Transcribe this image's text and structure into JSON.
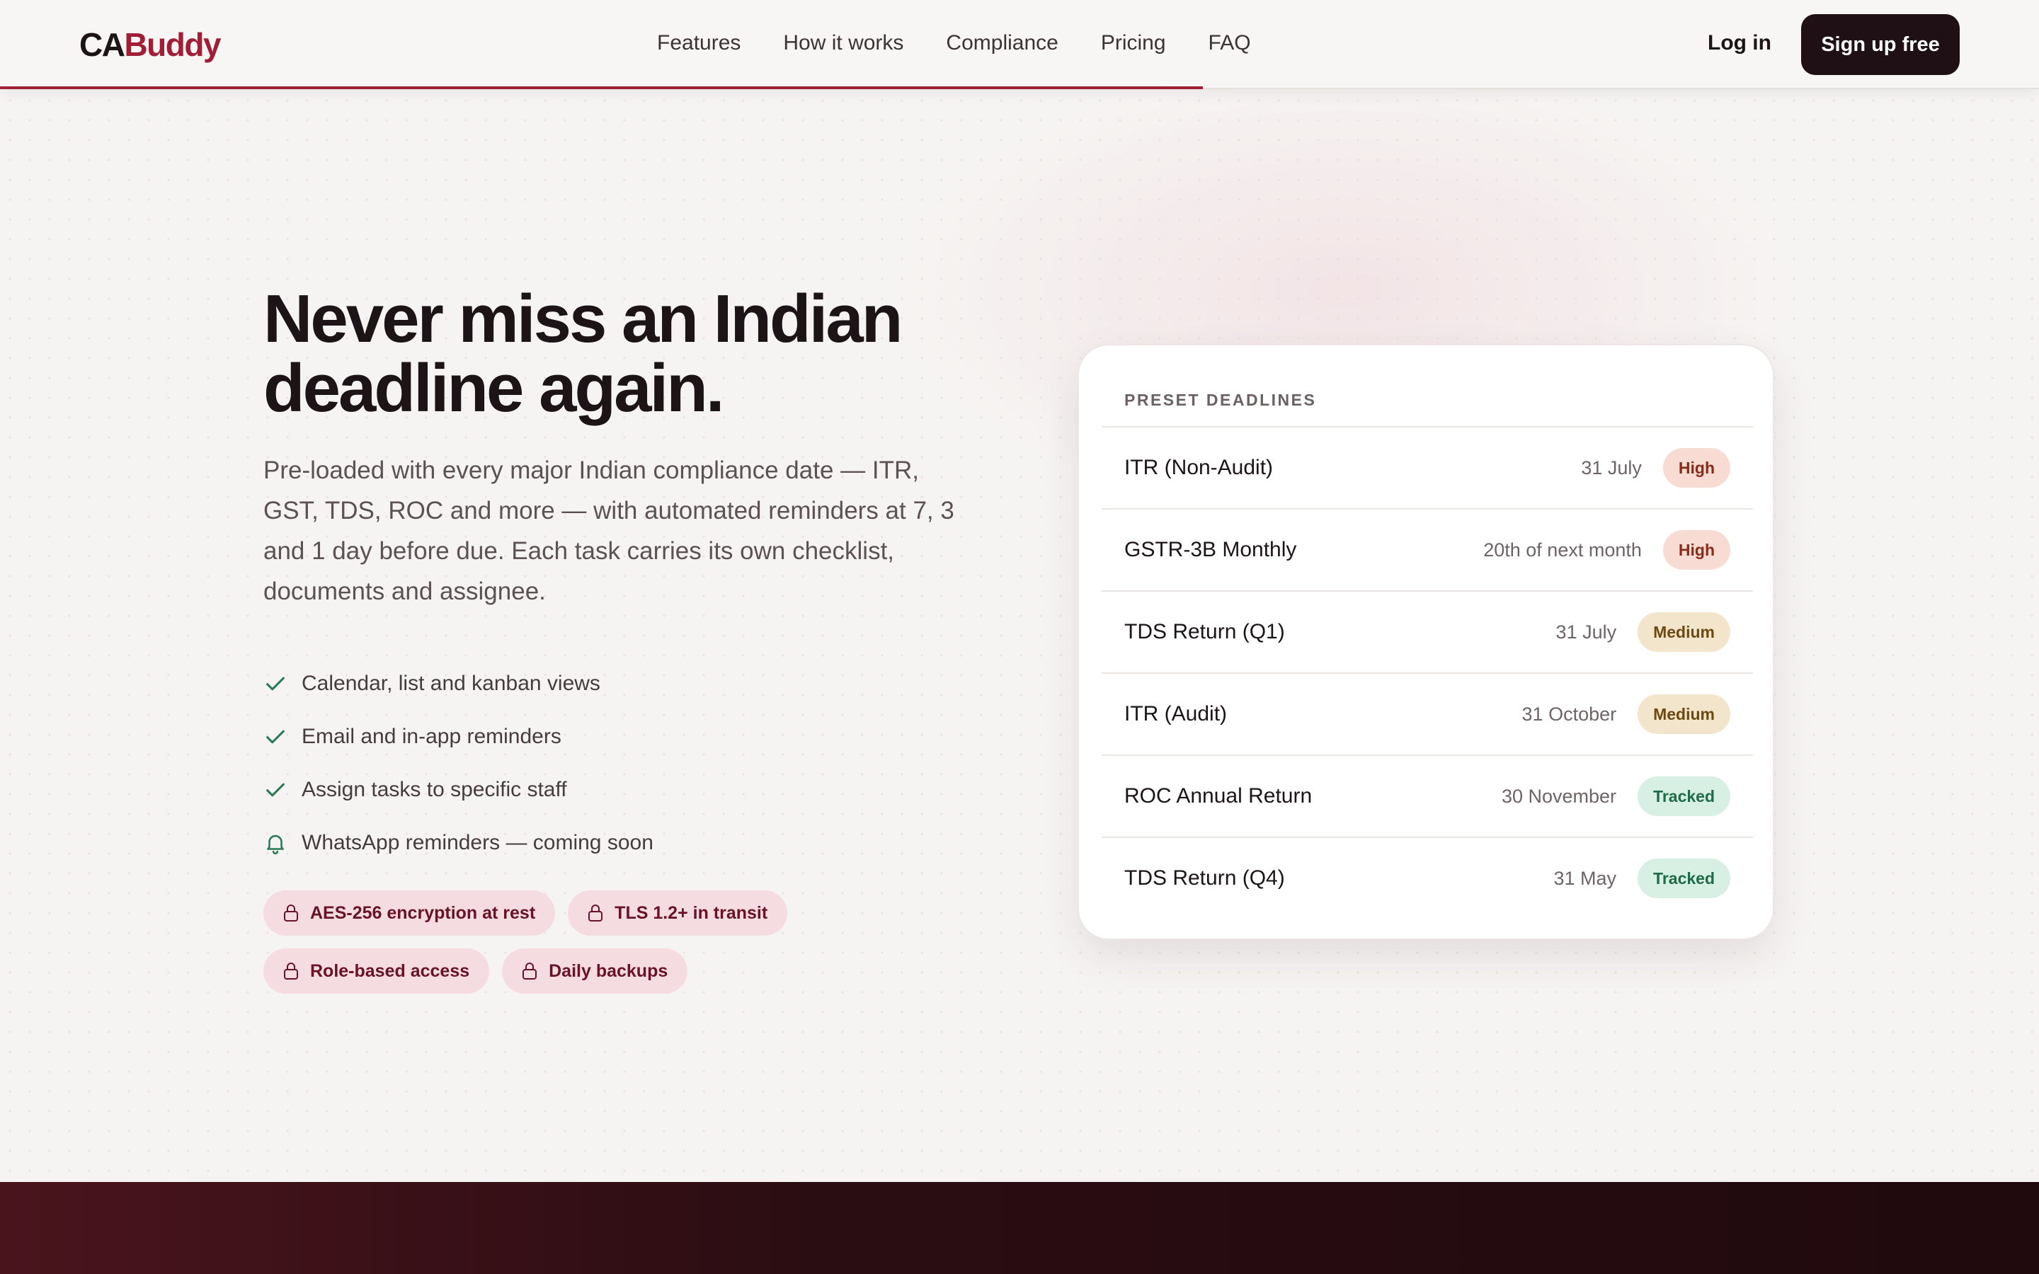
{
  "brand": {
    "logo_dark": "CA",
    "logo_accent": "Buddy"
  },
  "nav": {
    "items": [
      "Features",
      "How it works",
      "Compliance",
      "Pricing",
      "FAQ"
    ]
  },
  "header": {
    "login_label": "Log in",
    "signup_label": "Sign up free",
    "scroll_progress_fraction": 0.59
  },
  "hero": {
    "title": "Never miss an Indian deadline again.",
    "subtitle": "Pre-loaded with every major Indian compliance date — ITR, GST, TDS, ROC and more — with automated reminders at 7, 3 and 1 day before due. Each task carries its own checklist, documents and assignee.",
    "features": [
      {
        "icon": "check-icon",
        "text": "Calendar, list and kanban views"
      },
      {
        "icon": "check-icon",
        "text": "Email and in-app reminders"
      },
      {
        "icon": "check-icon",
        "text": "Assign tasks to specific staff"
      },
      {
        "icon": "bell-icon",
        "text": "WhatsApp reminders — coming soon"
      }
    ],
    "security_chips": [
      {
        "icon": "lock-icon",
        "text": "AES-256 encryption at rest"
      },
      {
        "icon": "lock-icon",
        "text": "TLS 1.2+ in transit"
      },
      {
        "icon": "lock-icon",
        "text": "Role-based access"
      },
      {
        "icon": "lock-icon",
        "text": "Daily backups"
      }
    ]
  },
  "deadlines_card": {
    "heading": "PRESET DEADLINES",
    "rows": [
      {
        "name": "ITR (Non-Audit)",
        "date": "31 July",
        "priority": "High",
        "level": "high"
      },
      {
        "name": "GSTR-3B Monthly",
        "date": "20th of next month",
        "priority": "High",
        "level": "high"
      },
      {
        "name": "TDS Return (Q1)",
        "date": "31 July",
        "priority": "Medium",
        "level": "medium"
      },
      {
        "name": "ITR (Audit)",
        "date": "31 October",
        "priority": "Medium",
        "level": "medium"
      },
      {
        "name": "ROC Annual Return",
        "date": "30 November",
        "priority": "Tracked",
        "level": "tracked"
      },
      {
        "name": "TDS Return (Q4)",
        "date": "31 May",
        "priority": "Tracked",
        "level": "tracked"
      }
    ]
  },
  "colors": {
    "accent": "#a11f36",
    "dark": "#1e1014",
    "check": "#2a7a55",
    "chip_bg": "#f5dce1"
  }
}
